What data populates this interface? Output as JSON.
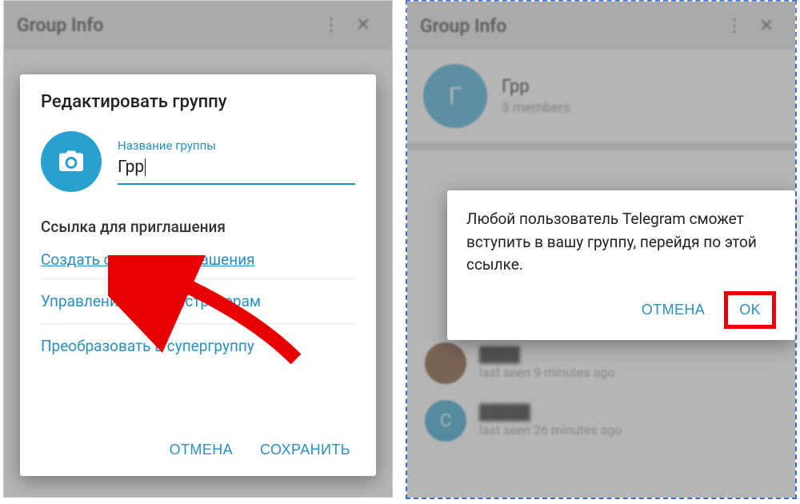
{
  "left": {
    "header": {
      "title": "Group Info"
    },
    "dialog": {
      "title": "Редактировать группу",
      "group_name_label": "Название группы",
      "group_name_value": "Грр",
      "invite_section": "Ссылка для приглашения",
      "create_link": "Создать ссылку приглашения",
      "manage_admins": "Управление администраторам",
      "convert_supergroup": "Преобразовать в супергруппу",
      "cancel": "ОТМЕНА",
      "save": "СОХРАНИТЬ"
    }
  },
  "right": {
    "header": {
      "title": "Group Info"
    },
    "group": {
      "avatar_letter": "Г",
      "name": "Грр",
      "members": "3 members"
    },
    "rows": [
      {
        "letter": "",
        "sub": "last seen 9 minutes ago"
      },
      {
        "letter": "C",
        "sub": "last seen 26 minutes ago"
      }
    ],
    "dialog": {
      "text": "Любой пользователь Telegram сможет вступить в вашу группу, перейдя по этой ссылке.",
      "cancel": "ОТМЕНА",
      "ok": "OK"
    }
  }
}
